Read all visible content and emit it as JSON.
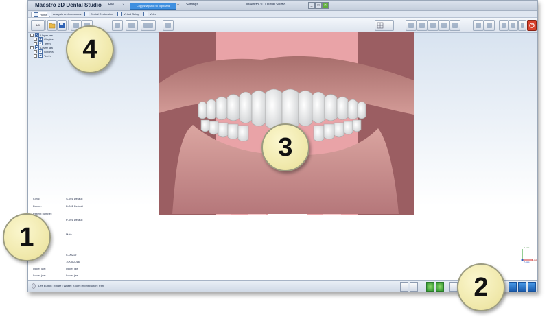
{
  "app": {
    "title": "Maestro 3D Dental Studio",
    "menu": [
      "File",
      "?",
      "Settings"
    ],
    "copy_button": "Copy snapshot to clipboard",
    "window_title": "Maestro 3D Dental Studio",
    "window_buttons": [
      "_",
      "□",
      "✕"
    ]
  },
  "tabs": [
    {
      "label": "Home",
      "active": true
    },
    {
      "label": "Analysis and measures",
      "active": false
    },
    {
      "label": "Dental Restoration",
      "active": false
    },
    {
      "label": "Virtual Setup",
      "active": false
    },
    {
      "label": "Video",
      "active": false
    }
  ],
  "toolbar": {
    "zoom_value": "1/8"
  },
  "tree": [
    {
      "label": "Upper jaw",
      "level": 0
    },
    {
      "label": "Gingiva",
      "level": 1
    },
    {
      "label": "Teeth",
      "level": 1
    },
    {
      "label": "Lower jaw",
      "level": 0
    },
    {
      "label": "Gingiva",
      "level": 1
    },
    {
      "label": "Teeth",
      "level": 1
    }
  ],
  "patient_info": [
    {
      "label": "Clinic:",
      "value": "S-001 Default"
    },
    {
      "label": "Doctor:",
      "value": "D-001 Default"
    },
    {
      "label": "Patient number:",
      "value": ""
    },
    {
      "label": "Patient:",
      "value": "P-001 Default"
    },
    {
      "label": "Sex:",
      "value": ""
    },
    {
      "label": "Patient Sex:",
      "value": "Male"
    },
    {
      "label": "Date of birth:",
      "value": ""
    },
    {
      "label": "Patient age:",
      "value": ""
    },
    {
      "label": "Case ID:",
      "value": "C-00219"
    },
    {
      "label": "",
      "value": "10/05/2016"
    },
    {
      "label": "Upper jaw:",
      "value": "Upper jaw"
    },
    {
      "label": "Lower jaw:",
      "value": "Lower jaw"
    }
  ],
  "status": {
    "text": "Left Button: Rotate | Wheel: Zoom | Right Button: Pan"
  },
  "axes": {
    "y": "Y-Axis",
    "x": "X-Axis",
    "z": "Z-Axis"
  },
  "callouts": [
    "4",
    "3",
    "1",
    "2"
  ],
  "colors": {
    "accent": "#3e8fe0",
    "gingiva": "#c98a86",
    "teeth": "#f4f4f2",
    "background_stripe": "#e9a3a7",
    "background_dark": "#9b5e62",
    "callout": "#efe7a8"
  },
  "icons": {
    "save": "floppy-disk-icon",
    "open": "folder-open-icon",
    "close": "power-icon"
  }
}
